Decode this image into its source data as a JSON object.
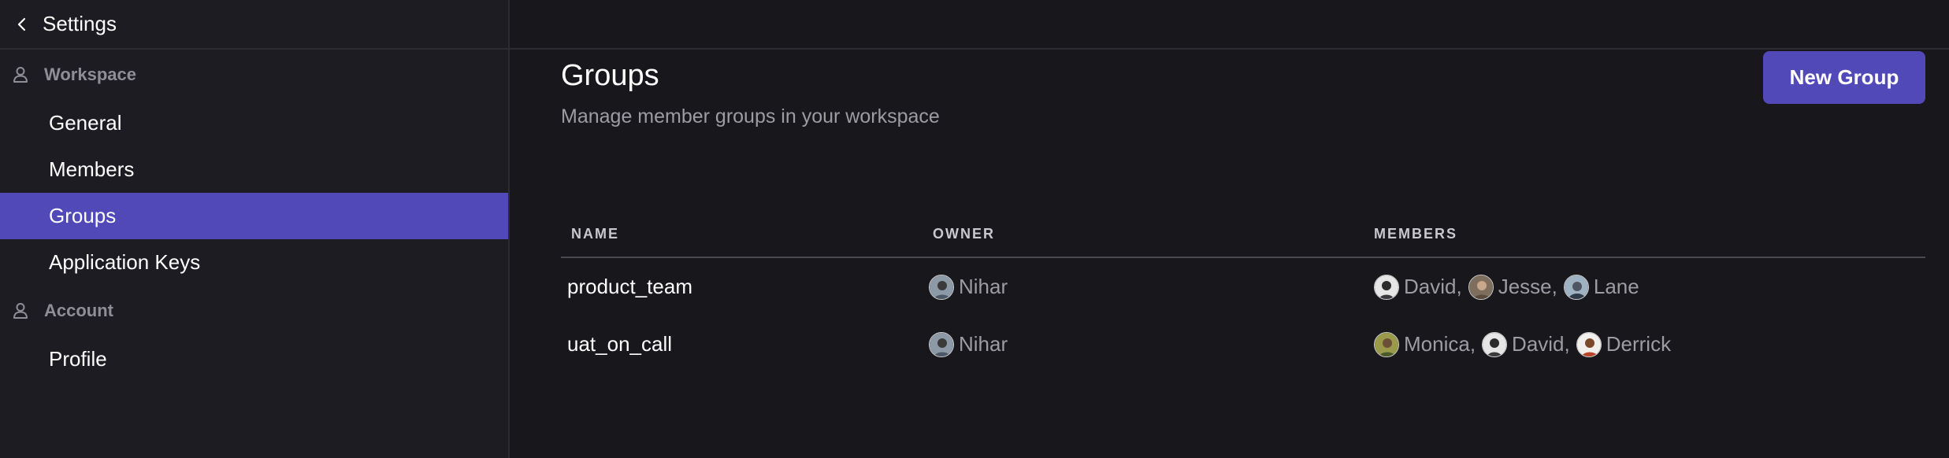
{
  "sidebar": {
    "title": "Settings",
    "sections": [
      {
        "label": "Workspace",
        "items": [
          "General",
          "Members",
          "Groups",
          "Application Keys"
        ]
      },
      {
        "label": "Account",
        "items": [
          "Profile"
        ]
      }
    ],
    "active_item": "Groups"
  },
  "page": {
    "title": "Groups",
    "subtitle": "Manage member groups in your workspace",
    "new_group_label": "New Group"
  },
  "table": {
    "headers": {
      "name": "NAME",
      "owner": "OWNER",
      "members": "MEMBERS"
    },
    "rows": [
      {
        "name": "product_team",
        "owner": "Nihar",
        "members": [
          "David,",
          "Jesse,",
          "Lane"
        ]
      },
      {
        "name": "uat_on_call",
        "owner": "Nihar",
        "members": [
          "Monica,",
          "David,",
          "Derrick"
        ]
      }
    ]
  },
  "colors": {
    "accent": "#5249b9",
    "background": "#18171c",
    "sidebar_bg": "#1d1c22"
  },
  "icons": {
    "back": "chevron-left-icon",
    "section": "person-icon"
  }
}
